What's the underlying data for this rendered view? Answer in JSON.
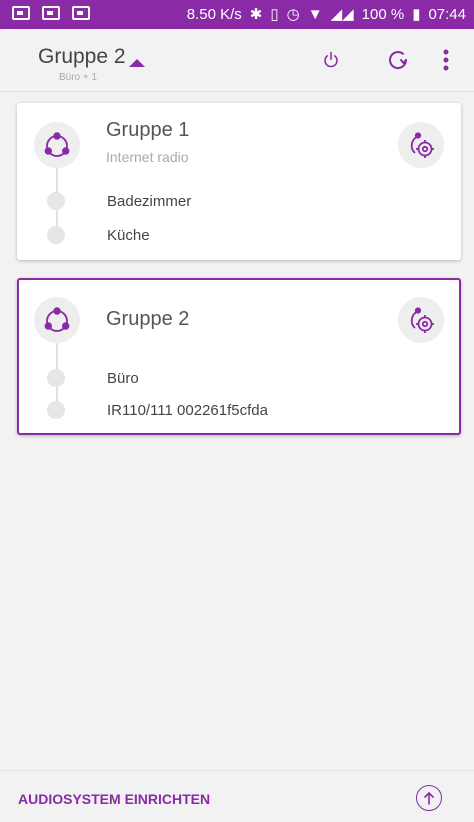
{
  "status_bar": {
    "speed": "8.50 K/s",
    "battery": "100 %",
    "time": "07:44"
  },
  "header": {
    "title": "Gruppe 2",
    "subtitle": "Büro + 1"
  },
  "groups": [
    {
      "name": "Gruppe 1",
      "source": "Internet radio",
      "members": [
        "Badezimmer",
        "Küche"
      ]
    },
    {
      "name": "Gruppe 2",
      "source": "",
      "members": [
        "Büro",
        "IR110/111 002261f5cfda"
      ]
    }
  ],
  "footer": {
    "setup_label": "AUDIOSYSTEM EINRICHTEN"
  },
  "colors": {
    "accent": "#8a2aa6",
    "background": "#f2f2f2"
  },
  "icons": [
    "power-icon",
    "refresh-icon",
    "more-vert-icon",
    "group-icon",
    "group-settings-icon",
    "arrow-up-icon"
  ]
}
